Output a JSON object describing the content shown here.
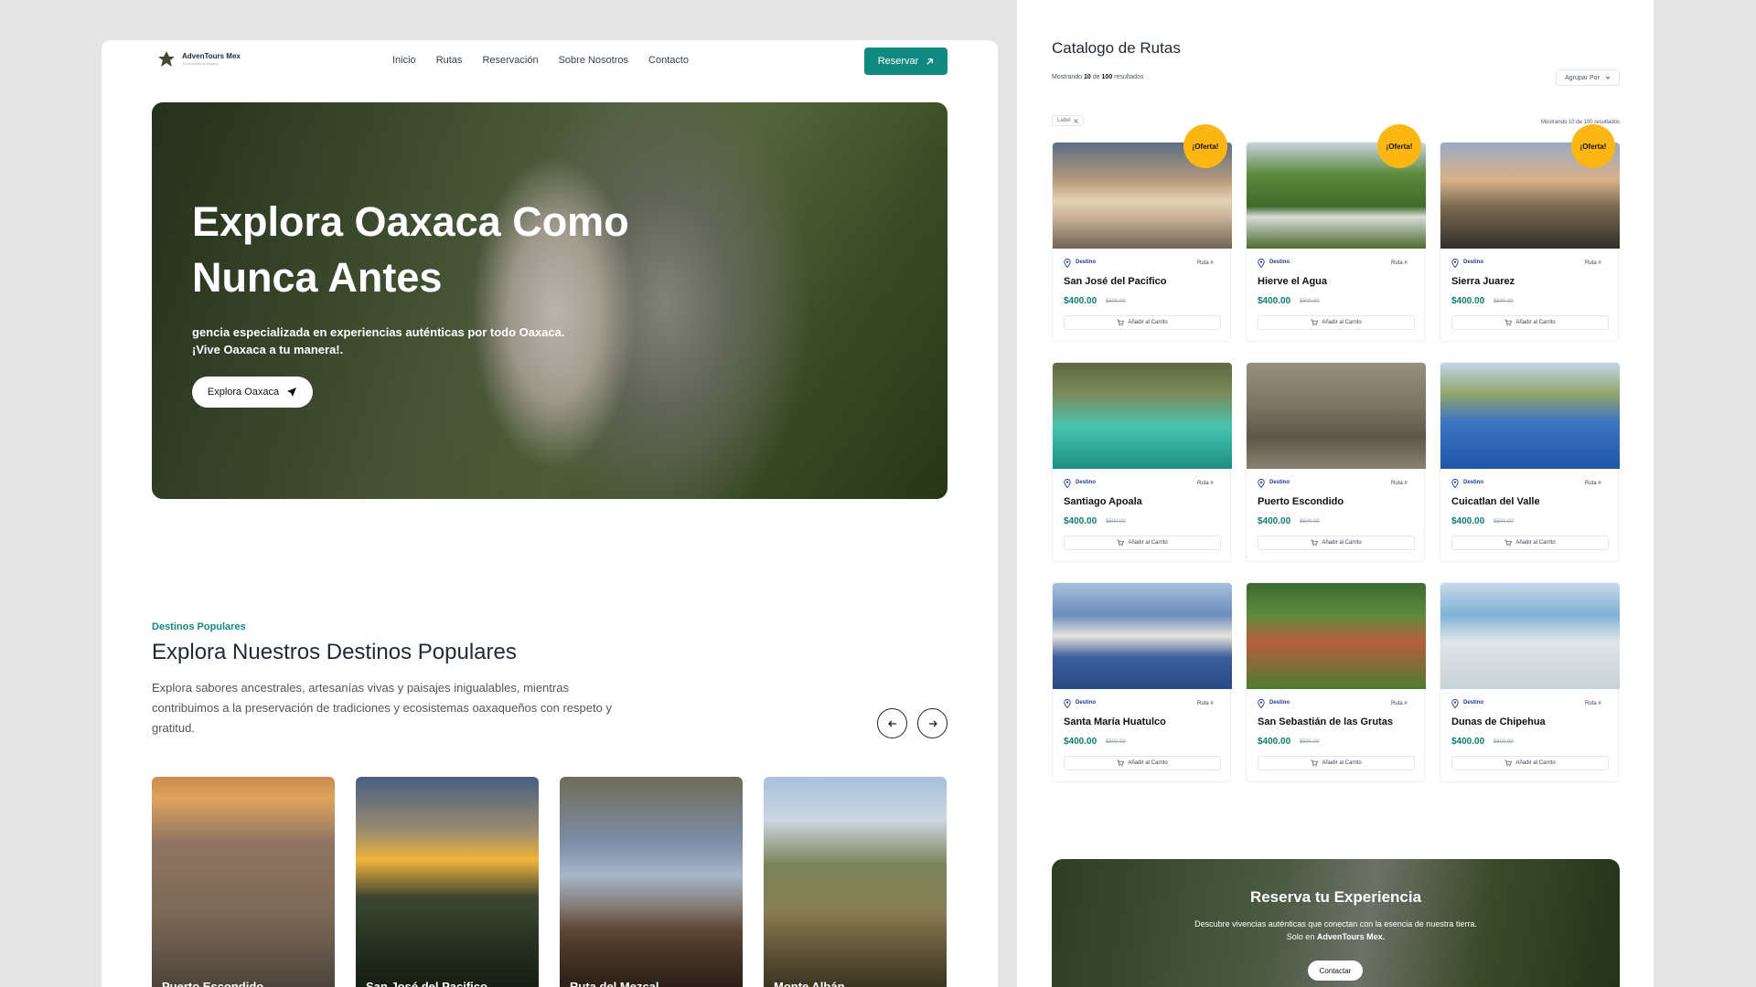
{
  "brand": {
    "name": "AdvenTours Mex",
    "tagline": "Tu Aventura te Espera"
  },
  "nav": {
    "links": [
      "Inicio",
      "Rutas",
      "Reservación",
      "Sobre Nosotros",
      "Contacto"
    ],
    "reserve_label": "Reservar"
  },
  "hero": {
    "title": "Explora Oaxaca Como Nunca Antes",
    "subtitle": "gencia especializada en experiencias auténticas por todo Oaxaca. ¡Vive Oaxaca a tu manera!.",
    "cta": "Explora Oaxaca"
  },
  "popular": {
    "eyebrow": "Destinos Populares",
    "title": "Explora Nuestros Destinos Populares",
    "description": "Explora sabores ancestrales, artesanías vivas y paisajes inigualables, mientras contribuimos a la preservación de tradiciones y ecosistemas oaxaqueños con respeto y gratitud.",
    "destinations": [
      "Puerto Escondido",
      "San José del Pacifico",
      "Ruta del Mezcal",
      "Monte Albán"
    ]
  },
  "catalog": {
    "title": "Catalogo de Rutas",
    "count_prefix": "Mostrando",
    "count_shown": "10",
    "count_mid": "de",
    "count_total": "100",
    "count_suffix": "resultados",
    "group_label": "Agrupar Por",
    "chip_label": "Label",
    "count_text": "Mostrando 10 de 100 resultados",
    "destino_tag": "Destino",
    "ruta_tag": "Ruta #",
    "cart_label": "Añadir al Carrito",
    "badge_label": "¡Oferta!",
    "cards": [
      {
        "name": "San José del Pacifico",
        "price": "$400.00",
        "old": "$500.00"
      },
      {
        "name": "Hierve el Agua",
        "price": "$400.00",
        "old": "$500.00"
      },
      {
        "name": "Sierra Juarez",
        "price": "$400.00",
        "old": "$500.00"
      },
      {
        "name": "Santiago Apoala",
        "price": "$400.00",
        "old": "$500.00"
      },
      {
        "name": "Puerto Escondido",
        "price": "$400.00",
        "old": "$500.00"
      },
      {
        "name": "Cuicatlan del Valle",
        "price": "$400.00",
        "old": "$500.00"
      },
      {
        "name": "Santa María Huatulco",
        "price": "$400.00",
        "old": "$500.00"
      },
      {
        "name": "San Sebastián de las Grutas",
        "price": "$400.00",
        "old": "$500.00"
      },
      {
        "name": "Dunas de Chipehua",
        "price": "$400.00",
        "old": "$500.00"
      }
    ]
  },
  "banner": {
    "title": "Reserva tu Experiencia",
    "line1": "Descubre vivencias auténticas que conectan con la esencia de nuestra tierra.",
    "line2_prefix": "Solo en",
    "line2_brand": "AdvenTours Mex.",
    "cta": "Contactar"
  },
  "colors": {
    "accent": "#11897f",
    "price": "#0e7c6e",
    "badge": "#fcb714",
    "background": "#e5e5e5"
  }
}
